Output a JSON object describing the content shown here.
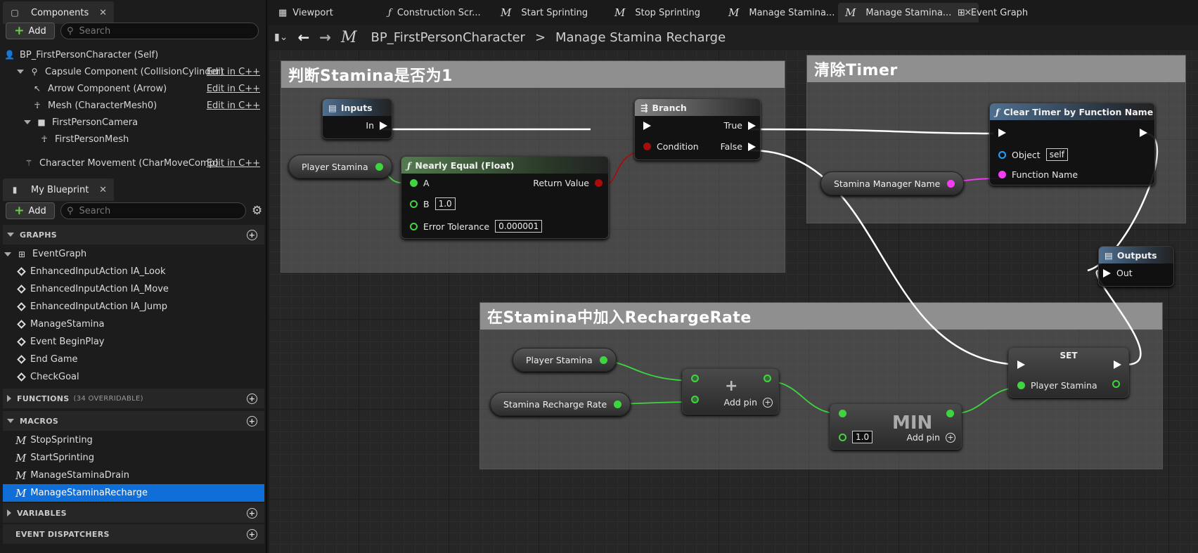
{
  "components": {
    "tab_label": "Components",
    "add_label": "Add",
    "search_placeholder": "Search",
    "items": [
      {
        "label": "BP_FirstPersonCharacter (Self)",
        "edit": ""
      },
      {
        "label": "Capsule Component (CollisionCylinder)",
        "edit": "Edit in C++"
      },
      {
        "label": "Arrow Component (Arrow)",
        "edit": "Edit in C++"
      },
      {
        "label": "Mesh (CharacterMesh0)",
        "edit": "Edit in C++"
      },
      {
        "label": "FirstPersonCamera",
        "edit": ""
      },
      {
        "label": "FirstPersonMesh",
        "edit": ""
      },
      {
        "label": "Character Movement (CharMoveComp)",
        "edit": "Edit in C++"
      }
    ]
  },
  "my_blueprint": {
    "tab_label": "My Blueprint",
    "add_label": "Add",
    "search_placeholder": "Search",
    "graphs_header": "GRAPHS",
    "event_graph": "EventGraph",
    "events": [
      "EnhancedInputAction IA_Look",
      "EnhancedInputAction IA_Move",
      "EnhancedInputAction IA_Jump",
      "ManageStamina",
      "Event BeginPlay",
      "End Game",
      "CheckGoal"
    ],
    "functions_header": "FUNCTIONS",
    "functions_note": "(34 OVERRIDABLE)",
    "macros_header": "MACROS",
    "macros": [
      "StopSprinting",
      "StartSprinting",
      "ManageStaminaDrain",
      "ManageStaminaRecharge"
    ],
    "variables_header": "VARIABLES",
    "dispatchers_header": "EVENT DISPATCHERS"
  },
  "doc_tabs": [
    "Viewport",
    "Construction Scr...",
    "Start Sprinting",
    "Stop Sprinting",
    "Manage Stamina...",
    "Manage Stamina...",
    "Event Graph"
  ],
  "breadcrumb": {
    "class": "BP_FirstPersonCharacter",
    "separator": ">",
    "graph": "Manage Stamina Recharge"
  },
  "comments": {
    "c1": "判断Stamina是否为1",
    "c2": "清除Timer",
    "c3": "在Stamina中加入RechargeRate"
  },
  "nodes": {
    "inputs": {
      "title": "Inputs",
      "pin": "In"
    },
    "branch": {
      "title": "Branch",
      "true": "True",
      "false": "False",
      "condition": "Condition"
    },
    "nearly_equal": {
      "title": "Nearly Equal (Float)",
      "a": "A",
      "b": "B",
      "b_value": "1.0",
      "tol": "Error Tolerance",
      "tol_value": "0.000001",
      "ret": "Return Value"
    },
    "player_stamina_1": "Player Stamina",
    "clear_timer": {
      "title": "Clear Timer by Function Name",
      "object": "Object",
      "object_value": "self",
      "fn": "Function Name"
    },
    "stamina_manager_name": "Stamina Manager Name",
    "outputs": {
      "title": "Outputs",
      "pin": "Out"
    },
    "player_stamina_2": "Player Stamina",
    "recharge_rate": "Stamina Recharge Rate",
    "add": {
      "symbol": "+",
      "add_pin": "Add pin"
    },
    "min": {
      "title": "MIN",
      "value": "1.0",
      "add_pin": "Add pin"
    },
    "set": {
      "title": "SET",
      "pin": "Player Stamina"
    }
  }
}
